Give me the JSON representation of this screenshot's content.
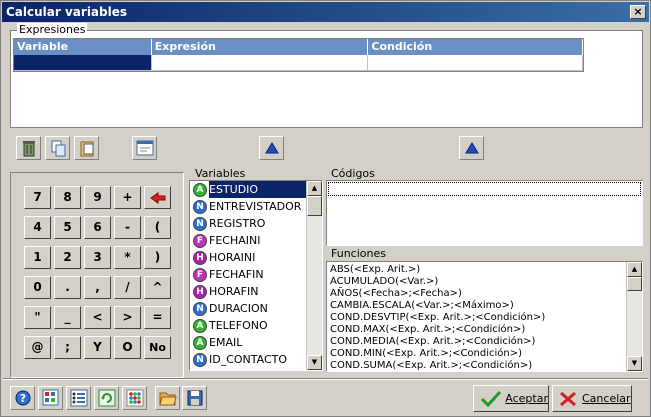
{
  "window": {
    "title": "Calcular variables",
    "close_glyph": "×"
  },
  "expresiones": {
    "label": "Expresiones",
    "columns": [
      "Variable",
      "Expresión",
      "Condición"
    ]
  },
  "toolbar": {
    "delete_icon": "trash-icon",
    "copy_icon": "copy-icon",
    "paste_icon": "paste-icon",
    "form_icon": "form-icon",
    "up_icon": "triangle-up-icon"
  },
  "calculator": {
    "keys": [
      [
        "7",
        "8",
        "9",
        "+",
        ""
      ],
      [
        "4",
        "5",
        "6",
        "-",
        "("
      ],
      [
        "1",
        "2",
        "3",
        "*",
        ")"
      ],
      [
        "0",
        ".",
        ",",
        "/",
        "^"
      ],
      [
        "\"",
        "_",
        "<",
        ">",
        "="
      ],
      [
        "@",
        ";",
        "Y",
        "O",
        "No"
      ]
    ]
  },
  "variables": {
    "label": "Variables",
    "items": [
      {
        "type": "A",
        "name": "ESTUDIO",
        "selected": true
      },
      {
        "type": "N",
        "name": "ENTREVISTADOR"
      },
      {
        "type": "N",
        "name": "REGISTRO"
      },
      {
        "type": "F",
        "name": "FECHAINI"
      },
      {
        "type": "H",
        "name": "HORAINI"
      },
      {
        "type": "F",
        "name": "FECHAFIN"
      },
      {
        "type": "H",
        "name": "HORAFIN"
      },
      {
        "type": "N",
        "name": "DURACION"
      },
      {
        "type": "A",
        "name": "TELEFONO"
      },
      {
        "type": "A",
        "name": "EMAIL"
      },
      {
        "type": "N",
        "name": "ID_CONTACTO"
      }
    ]
  },
  "codigos": {
    "label": "Códigos"
  },
  "funciones": {
    "label": "Funciones",
    "items": [
      "ABS(<Exp. Arit.>)",
      "ACUMULADO(<Var.>)",
      "AÑOS(<Fecha>;<Fecha>)",
      "CAMBIA.ESCALA(<Var.>;<Máximo>)",
      "COND.DESVTIP(<Exp. Arit.>;<Condición>)",
      "COND.MAX(<Exp. Arit.>;<Condición>)",
      "COND.MEDIA(<Exp. Arit.>;<Condición>)",
      "COND.MIN(<Exp. Arit.>;<Condición>)",
      "COND.SUMA(<Exp. Arit.>;<Condición>)"
    ]
  },
  "footer": {
    "aceptar": "Aceptar",
    "cancelar": "Cancelar"
  },
  "colors": {
    "title_start": "#0a246a",
    "grid_header": "#6a8fc4",
    "selection": "#0a246a",
    "badge_A": "#2fb52f",
    "badge_N": "#2f6fd6",
    "badge_F": "#c02fc0",
    "badge_H": "#b020b0"
  }
}
